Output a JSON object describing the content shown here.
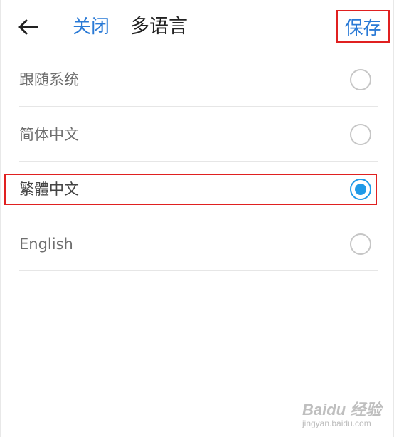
{
  "header": {
    "back_icon": "arrow-left-icon",
    "close_label": "关闭",
    "title": "多语言",
    "save_label": "保存"
  },
  "languages": [
    {
      "label": "跟随系统",
      "selected": false
    },
    {
      "label": "简体中文",
      "selected": false
    },
    {
      "label": "繁體中文",
      "selected": true
    },
    {
      "label": "English",
      "selected": false
    }
  ],
  "watermark": {
    "brand": "Baidu 经验",
    "sub": "jingyan.baidu.com"
  },
  "colors": {
    "accent": "#2a7ad6",
    "radio_checked": "#1f9ae8",
    "highlight": "#e02020"
  }
}
